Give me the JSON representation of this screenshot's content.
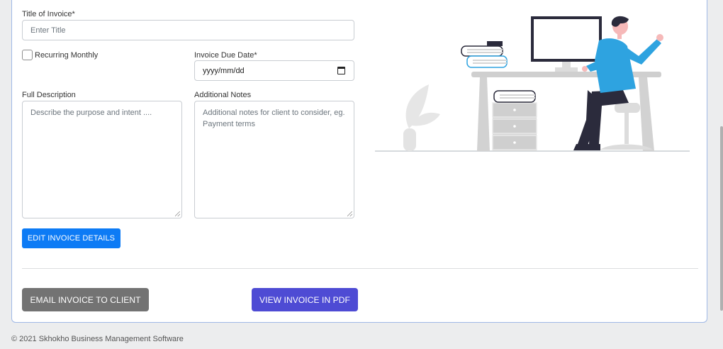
{
  "form": {
    "title_label": "Title of Invoice*",
    "title_placeholder": "Enter Title",
    "recurring_label": "Recurring Monthly",
    "recurring_checked": false,
    "due_date_label": "Invoice Due Date*",
    "due_date_value": "yyyy/mm/dd",
    "description_label": "Full Description",
    "description_placeholder": "Describe the purpose and intent ....",
    "notes_label": "Additional Notes",
    "notes_placeholder": "Additional notes for client to consider, eg. Payment terms"
  },
  "buttons": {
    "edit_label": "EDIT INVOICE DETAILS",
    "email_label": "EMAIL INVOICE TO CLIENT",
    "pdf_label": "VIEW INVOICE IN PDF"
  },
  "colors": {
    "primary": "#0d7bf5",
    "secondary": "#737373",
    "indigo": "#4e4bd4",
    "illustration_accent": "#2ea3e0"
  },
  "illustration": {
    "name": "person-working-at-desk-illustration"
  },
  "footer": {
    "text": "© 2021 Skhokho Business Management Software"
  }
}
